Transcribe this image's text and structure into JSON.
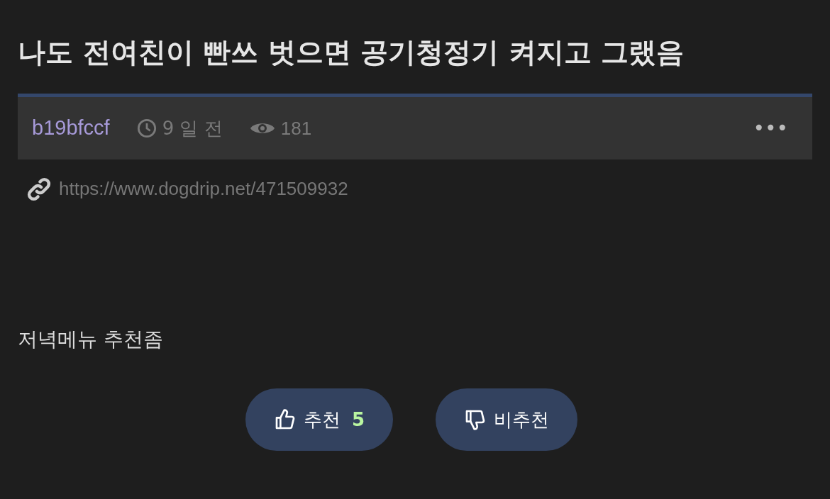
{
  "post": {
    "title": "나도 전여친이 빤쓰 벗으면 공기청정기 켜지고 그랬음",
    "author": "b19bfccf",
    "time": "9 일 전",
    "views": "181",
    "more": "•••",
    "url": "https://www.dogdrip.net/471509932",
    "body": "저녁메뉴 추천좀"
  },
  "votes": [
    {
      "kind": "up",
      "label": "추천",
      "count": "5"
    },
    {
      "kind": "down",
      "label": "비추천"
    }
  ]
}
